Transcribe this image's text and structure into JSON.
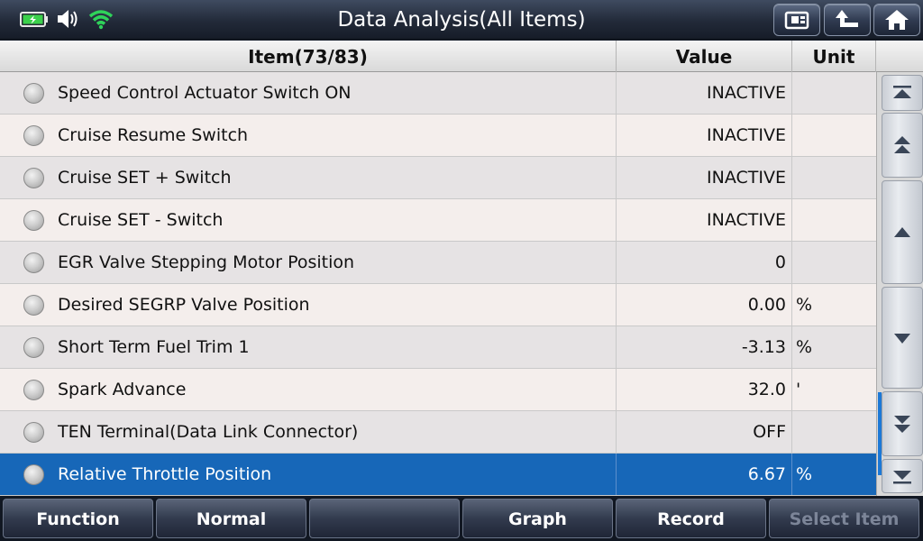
{
  "title": "Data Analysis(All Items)",
  "status_icons": [
    "battery-charging-icon",
    "speaker-icon",
    "wifi-icon"
  ],
  "toolbar_icons": [
    "screenshot-icon",
    "back-icon",
    "home-icon"
  ],
  "table": {
    "columns": {
      "item": "Item(73/83)",
      "value": "Value",
      "unit": "Unit"
    },
    "rows": [
      {
        "item": "Speed Control Actuator Switch ON",
        "value": "INACTIVE",
        "unit": ""
      },
      {
        "item": "Cruise Resume Switch",
        "value": "INACTIVE",
        "unit": ""
      },
      {
        "item": "Cruise SET + Switch",
        "value": "INACTIVE",
        "unit": ""
      },
      {
        "item": "Cruise SET - Switch",
        "value": "INACTIVE",
        "unit": ""
      },
      {
        "item": "EGR Valve Stepping Motor Position",
        "value": "0",
        "unit": ""
      },
      {
        "item": "Desired SEGRP Valve Position",
        "value": "0.00",
        "unit": "%"
      },
      {
        "item": "Short Term Fuel Trim 1",
        "value": "-3.13",
        "unit": "%"
      },
      {
        "item": "Spark Advance",
        "value": "32.0",
        "unit": "'"
      },
      {
        "item": "TEN Terminal(Data Link Connector)",
        "value": "OFF",
        "unit": ""
      },
      {
        "item": "Relative Throttle Position",
        "value": "6.67",
        "unit": "%"
      }
    ],
    "selected_index": 9
  },
  "scroll_icons": [
    "scroll-top-icon",
    "page-up-icon",
    "line-up-icon",
    "line-down-icon",
    "page-down-icon",
    "scroll-bottom-icon"
  ],
  "footer": {
    "function": "Function",
    "normal": "Normal",
    "empty": "",
    "graph": "Graph",
    "record": "Record",
    "select_item": "Select Item"
  },
  "colors": {
    "selected_row": "#1767b8",
    "wifi": "#2fd35a",
    "battery": "#3bd14b"
  }
}
